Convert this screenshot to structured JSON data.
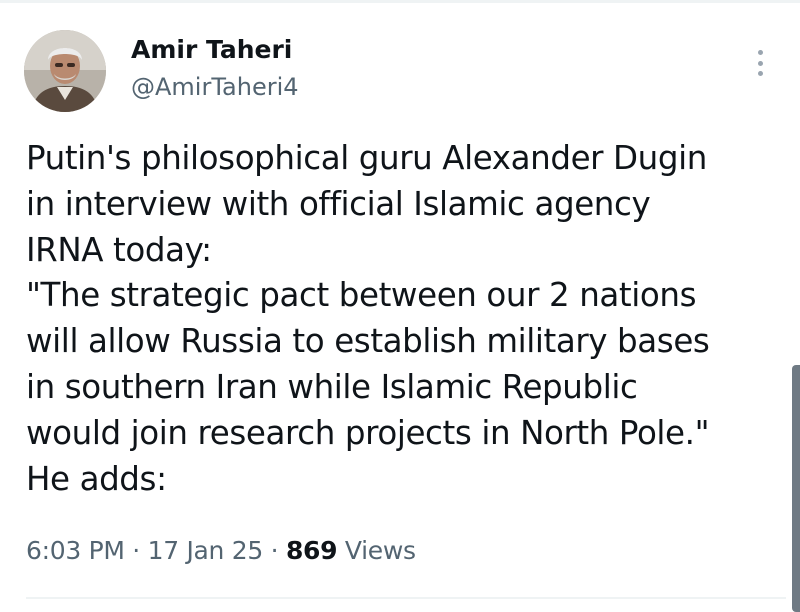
{
  "author": {
    "display_name": "Amir Taheri",
    "handle": "@AmirTaheri4",
    "avatar_icon": "profile-photo"
  },
  "more_icon": "more-options-icon",
  "tweet": {
    "lines": [
      "Putin's philosophical guru Alexander Dugin",
      "in interview with official Islamic agency",
      "IRNA today:",
      "\"The strategic pact between our 2 nations",
      "will allow Russia to establish military bases",
      "in southern Iran while Islamic Republic",
      "would join research projects in North Pole.\"",
      "He adds:"
    ]
  },
  "meta": {
    "time": "6:03 PM",
    "separator": "·",
    "date": "17 Jan 25",
    "views_count": "869",
    "views_label": "Views"
  },
  "colors": {
    "text_primary": "#0f1419",
    "text_secondary": "#536471",
    "divider": "#eff3f4"
  }
}
